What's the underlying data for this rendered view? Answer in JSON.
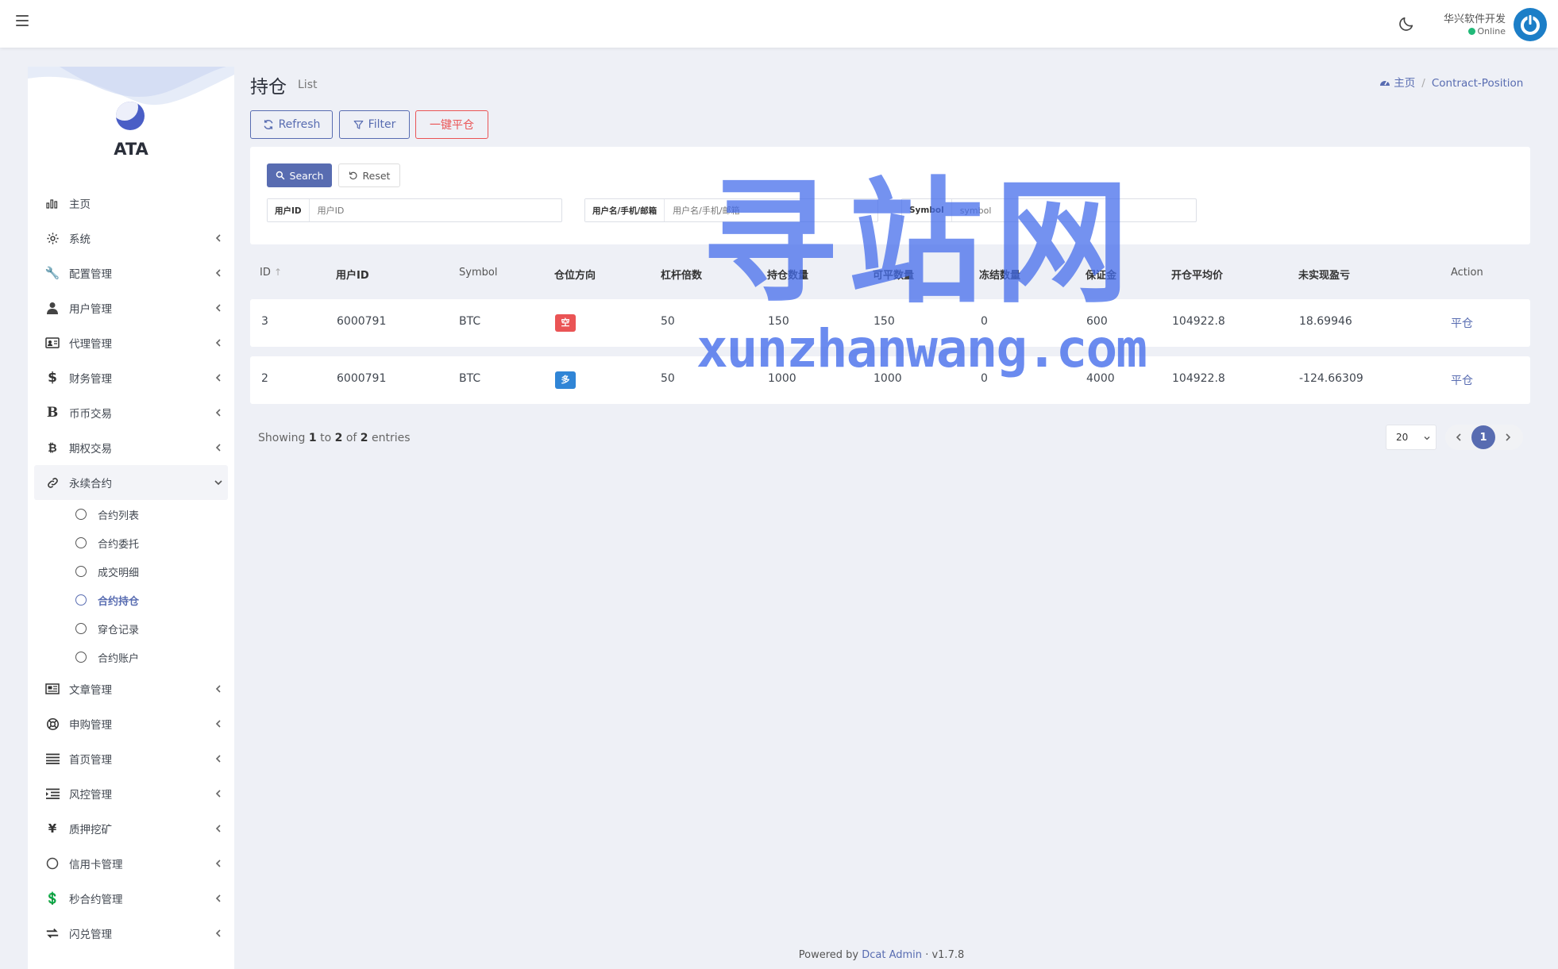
{
  "header": {
    "user_name": "华兴软件开发",
    "user_status": "Online"
  },
  "sidebar": {
    "brand": "ATA",
    "items": [
      {
        "label": "主页",
        "icon": "bar-chart-icon"
      },
      {
        "label": "系统",
        "icon": "gear-icon"
      },
      {
        "label": "配置管理",
        "icon": "wrench-icon"
      },
      {
        "label": "用户管理",
        "icon": "user-icon"
      },
      {
        "label": "代理管理",
        "icon": "id-card-icon"
      },
      {
        "label": "财务管理",
        "icon": "dollar-icon"
      },
      {
        "label": "币币交易",
        "icon": "bitcoin-b-icon"
      },
      {
        "label": "期权交易",
        "icon": "bitcoin-icon"
      },
      {
        "label": "永续合约",
        "icon": "link-icon"
      },
      {
        "label": "文章管理",
        "icon": "newspaper-icon"
      },
      {
        "label": "申购管理",
        "icon": "life-ring-icon"
      },
      {
        "label": "首页管理",
        "icon": "list-icon"
      },
      {
        "label": "风控管理",
        "icon": "indent-icon"
      },
      {
        "label": "质押挖矿",
        "icon": "yen-icon"
      },
      {
        "label": "信用卡管理",
        "icon": "circle-icon"
      },
      {
        "label": "秒合约管理",
        "icon": "dollar-sign-icon"
      },
      {
        "label": "闪兑管理",
        "icon": "exchange-icon"
      }
    ],
    "subitems": [
      {
        "label": "合约列表"
      },
      {
        "label": "合约委托"
      },
      {
        "label": "成交明细"
      },
      {
        "label": "合约持仓"
      },
      {
        "label": "穿仓记录"
      },
      {
        "label": "合约账户"
      }
    ]
  },
  "page": {
    "title": "持仓",
    "subtitle": "List",
    "breadcrumb_home": "主页",
    "breadcrumb_current": "Contract-Position"
  },
  "toolbar": {
    "refresh": "Refresh",
    "filter": "Filter",
    "close_all": "一键平仓"
  },
  "filter": {
    "search": "Search",
    "reset": "Reset",
    "fields": [
      {
        "label": "用户ID",
        "placeholder": "用户ID"
      },
      {
        "label": "用户名/手机/邮箱",
        "placeholder": "用户名/手机/邮箱"
      },
      {
        "label": "Symbol",
        "placeholder": "symbol"
      }
    ]
  },
  "table": {
    "headers": [
      "ID",
      "用户ID",
      "Symbol",
      "仓位方向",
      "杠杆倍数",
      "持仓数量",
      "可平数量",
      "冻结数量",
      "保证金",
      "开仓平均价",
      "未实现盈亏",
      "Action"
    ],
    "rows": [
      {
        "id": "3",
        "uid": "6000791",
        "symbol": "BTC",
        "side": "空",
        "side_color": "#ea5455",
        "leverage": "50",
        "qty": "150",
        "avail": "150",
        "frozen": "0",
        "margin": "600",
        "avg_price": "104922.8",
        "pnl": "18.69946",
        "action": "平仓"
      },
      {
        "id": "2",
        "uid": "6000791",
        "symbol": "BTC",
        "side": "多",
        "side_color": "#3085d6",
        "leverage": "50",
        "qty": "1000",
        "avail": "1000",
        "frozen": "0",
        "margin": "4000",
        "avg_price": "104922.8",
        "pnl": "-124.66309",
        "action": "平仓"
      }
    ]
  },
  "pagination": {
    "showing": "Showing",
    "from": "1",
    "to_word": "to",
    "to": "2",
    "of_word": "of",
    "total": "2",
    "entries": "entries",
    "page_size": "20",
    "current_page": "1"
  },
  "footer": {
    "powered": "Powered by",
    "link": "Dcat Admin",
    "sep": "·",
    "version": "v1.7.8"
  },
  "watermark": {
    "big": "寻站网",
    "small": "xunzhanwang.com"
  },
  "colors": {
    "primary": "#586cb1",
    "danger": "#ea5455",
    "info": "#3085d6",
    "online": "#21b978",
    "background": "#eef0f6"
  }
}
